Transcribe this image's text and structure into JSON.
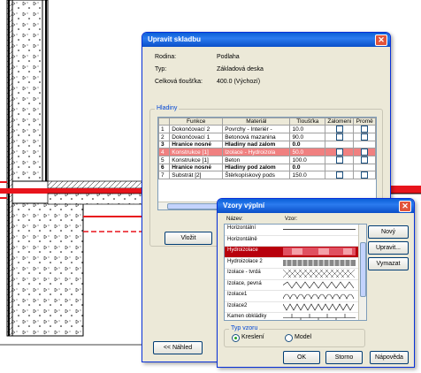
{
  "dialog1": {
    "title": "Upravit skladbu",
    "fields": [
      {
        "label": "Rodina:",
        "value": "Podlaha"
      },
      {
        "label": "Typ:",
        "value": "Základová deska"
      },
      {
        "label": "Celková tloušťka:",
        "value": "400.0 (Výchozí)"
      }
    ],
    "group_title": "Hladiny",
    "columns": [
      "",
      "Funkce",
      "Materiál",
      "Tloušťka",
      "Zalomení",
      "Proměnná"
    ],
    "column_display": [
      "",
      "Funkce",
      "Materiál",
      "Tloušťka",
      "Zalomeni",
      "Promě"
    ],
    "rows": [
      {
        "num": "1",
        "funkce": "Dokončovací 2",
        "material": "Povrchy - Interiér -",
        "tloustka": "10.0"
      },
      {
        "num": "2",
        "funkce": "Dokončovací 1",
        "material": "Betonová mazanina",
        "tloustka": "90.0"
      },
      {
        "num": "3",
        "funkce": "Hranice nosné",
        "material": "Hladiny nad zalom",
        "tloustka": "0.0"
      },
      {
        "num": "4",
        "funkce": "Konstrukce [1]",
        "material": "Izolace - Hydroizola",
        "tloustka": "50.0"
      },
      {
        "num": "5",
        "funkce": "Konstrukce [1]",
        "material": "Beton",
        "tloustka": "100.0"
      },
      {
        "num": "6",
        "funkce": "Hranice nosné",
        "material": "Hladiny pod zalom",
        "tloustka": "0.0"
      },
      {
        "num": "7",
        "funkce": "Substrát [2]",
        "material": "Štěrkopískový pods",
        "tloustka": "150.0"
      }
    ],
    "insert_button": "Vložit",
    "preview_button": "<< Náhled"
  },
  "dialog2": {
    "title": "Vzory výplní",
    "col_name": "Název:",
    "col_pattern": "Vzor:",
    "patterns": [
      {
        "name": "Horizontální",
        "swatch": "hline"
      },
      {
        "name": "Horizontálně",
        "swatch": "empty"
      },
      {
        "name": "Hydroizolace",
        "swatch": "hydro"
      },
      {
        "name": "Hydroizolace 2",
        "swatch": "hydro2"
      },
      {
        "name": "Izolace - tvrdá",
        "swatch": "hatch"
      },
      {
        "name": "Izolace, pevná",
        "swatch": "wave"
      },
      {
        "name": "Izolace1",
        "swatch": "loops"
      },
      {
        "name": "Izolace2",
        "swatch": "zigzag"
      },
      {
        "name": "Kamen obkládky",
        "swatch": "stone"
      }
    ],
    "buttons": {
      "new": "Nový",
      "edit": "Upravit...",
      "delete": "Vymazat"
    },
    "group_title": "Typ vzoru",
    "radio_drafting": "Kreslení",
    "radio_model": "Model",
    "ok": "OK",
    "cancel": "Storno",
    "help": "Nápověda"
  },
  "colors": {
    "accent_red": "#e8141c",
    "selected_row": "#f08080",
    "xp_title": "#0a5fd6"
  }
}
